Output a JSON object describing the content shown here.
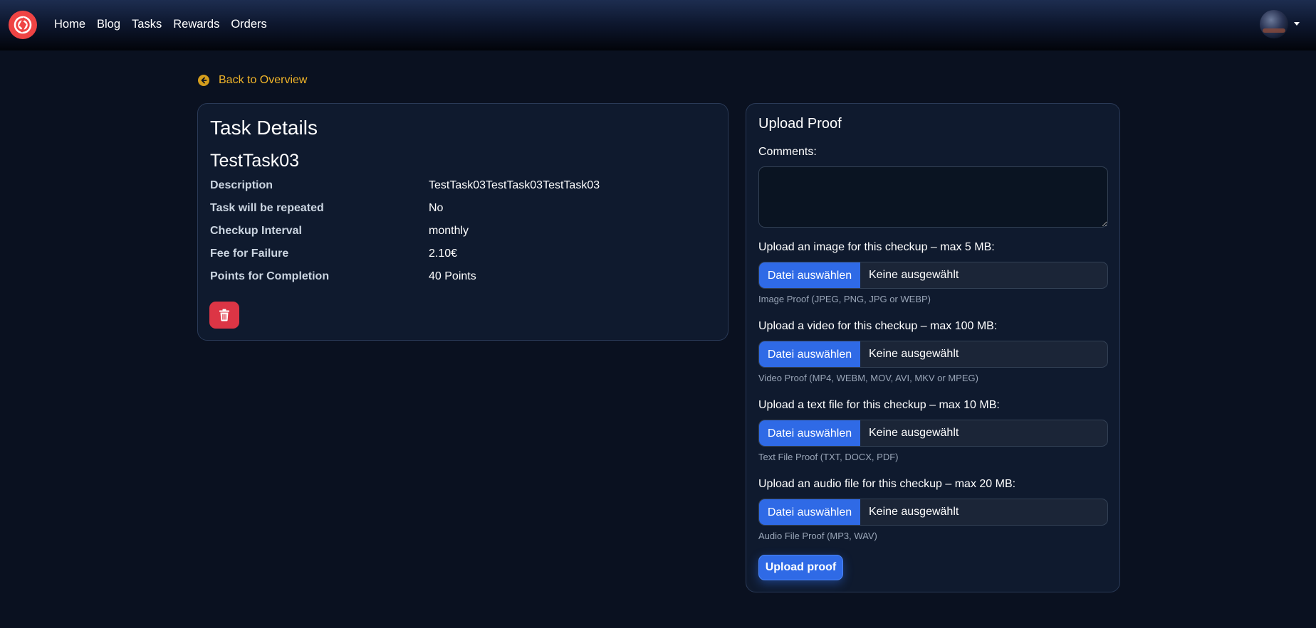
{
  "nav": {
    "links": [
      "Home",
      "Blog",
      "Tasks",
      "Rewards",
      "Orders"
    ]
  },
  "back_link": "Back to Overview",
  "task_card": {
    "title": "Task Details",
    "task_name": "TestTask03",
    "details": [
      {
        "label": "Description",
        "value": "TestTask03TestTask03TestTask03"
      },
      {
        "label": "Task will be repeated",
        "value": "No"
      },
      {
        "label": "Checkup Interval",
        "value": "monthly"
      },
      {
        "label": "Fee for Failure",
        "value": "2.10€"
      },
      {
        "label": "Points for Completion",
        "value": "40 Points"
      }
    ]
  },
  "upload_card": {
    "title": "Upload Proof",
    "comments_label": "Comments:",
    "comments_value": "",
    "uploads": [
      {
        "label": "Upload an image for this checkup – max 5 MB:",
        "button": "Datei auswählen",
        "status": "Keine ausgewählt",
        "hint": "Image Proof (JPEG, PNG, JPG or WEBP)"
      },
      {
        "label": "Upload a video for this checkup – max 100 MB:",
        "button": "Datei auswählen",
        "status": "Keine ausgewählt",
        "hint": "Video Proof (MP4, WEBM, MOV, AVI, MKV or MPEG)"
      },
      {
        "label": "Upload a text file for this checkup – max 10 MB:",
        "button": "Datei auswählen",
        "status": "Keine ausgewählt",
        "hint": "Text File Proof (TXT, DOCX, PDF)"
      },
      {
        "label": "Upload an audio file for this checkup – max 20 MB:",
        "button": "Datei auswählen",
        "status": "Keine ausgewählt",
        "hint": "Audio File Proof (MP3, WAV)"
      }
    ],
    "submit": "Upload proof"
  },
  "colors": {
    "background": "#0a1120",
    "card": "#0f1a2e",
    "accent_blue": "#2f6ae6",
    "danger_red": "#dc3545",
    "link_gold": "#f0b429",
    "logo_red": "#ef4444"
  },
  "icons": {
    "logo": "app-logo-icon",
    "back": "arrow-left-circle-icon",
    "delete": "trash-icon",
    "avatar": "user-avatar",
    "caret": "caret-down-icon"
  }
}
